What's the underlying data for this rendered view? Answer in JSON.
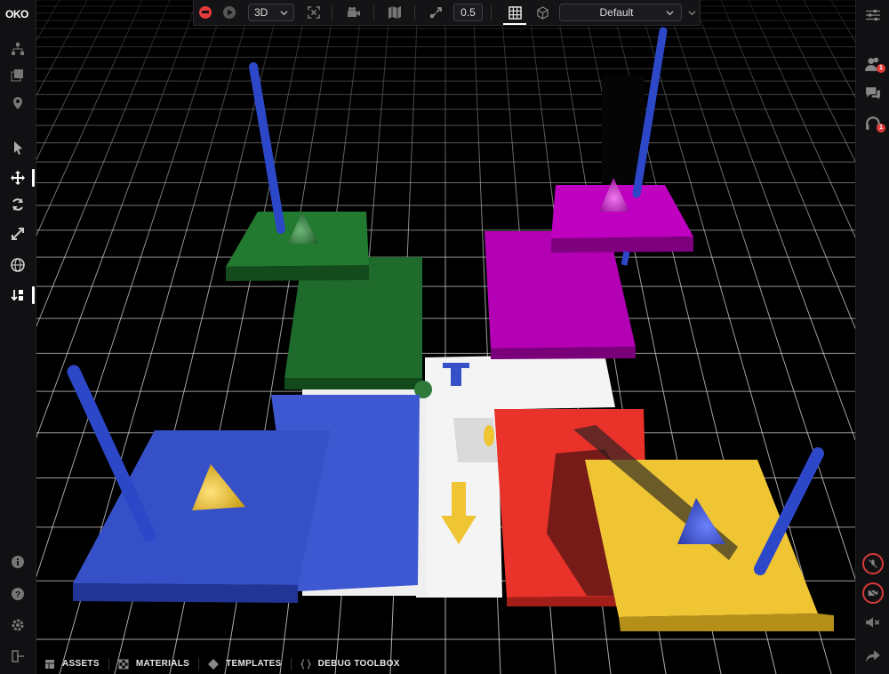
{
  "app": {
    "logo_text": "OKO"
  },
  "toolbar": {
    "view_mode": "3D",
    "snap_value": "0.5",
    "environment": "Default"
  },
  "bottom_tabs": [
    {
      "label": "ASSETS"
    },
    {
      "label": "MATERIALS"
    },
    {
      "label": "TEMPLATES"
    },
    {
      "label": "DEBUG TOOLBOX"
    }
  ],
  "right_panel": {
    "people_badge": "1",
    "voice_badge": "1"
  },
  "scene": {
    "colors": {
      "green": "#1f6b2c",
      "magenta": "#b400b4",
      "blue": "#3651c8",
      "red": "#e8322a",
      "yellow": "#f0c534",
      "white": "#f2f2f2",
      "grid": "#e8e8e8"
    }
  }
}
